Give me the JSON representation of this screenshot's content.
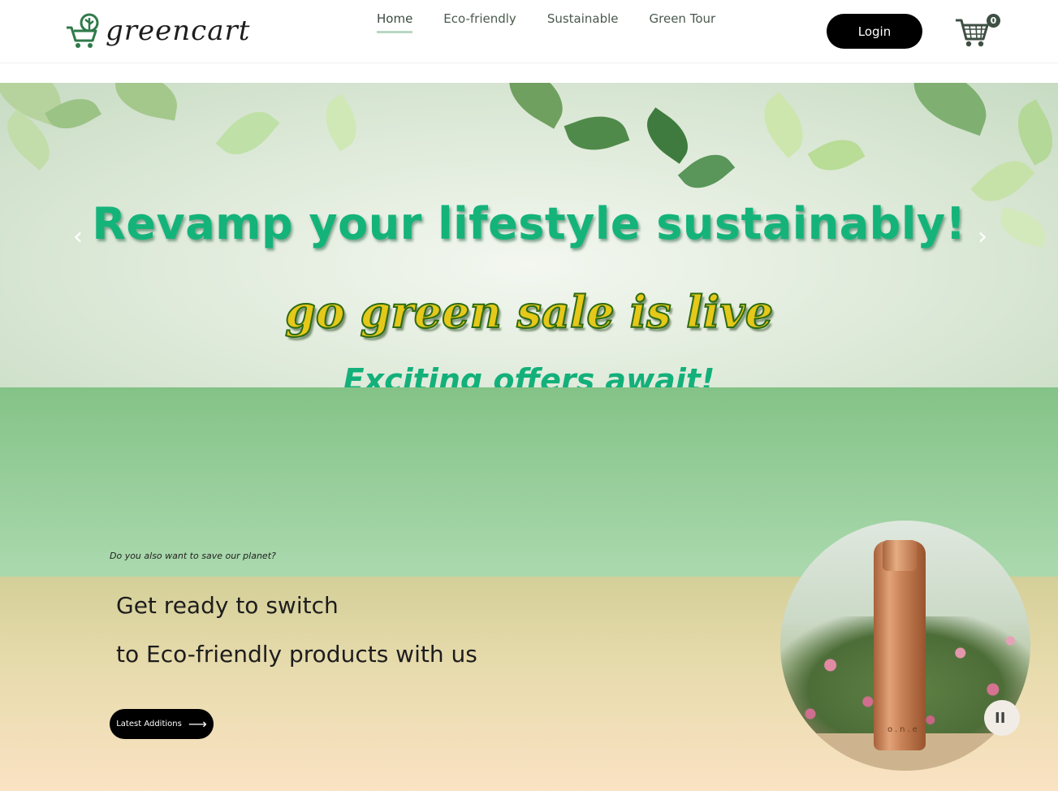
{
  "brand": {
    "name": "greencart"
  },
  "nav": {
    "items": [
      {
        "label": "Home",
        "active": true
      },
      {
        "label": "Eco-friendly",
        "active": false
      },
      {
        "label": "Sustainable",
        "active": false
      },
      {
        "label": "Green Tour",
        "active": false
      }
    ]
  },
  "header": {
    "login_label": "Login",
    "cart_count": "0"
  },
  "hero": {
    "title": "Revamp your lifestyle sustainably!",
    "sale": "go green sale is live",
    "offers": "Exciting offers await!",
    "prev_icon": "chevron-left-icon",
    "next_icon": "chevron-right-icon"
  },
  "promo": {
    "question": "Do you also want to save our planet?",
    "line_one": "Get ready to switch",
    "line_two": "to Eco-friendly products with us",
    "button_label": "Latest Additions",
    "button_icon": "arrow-right-icon",
    "product_brand": "o.n.e",
    "pause_label": "II"
  },
  "colors": {
    "accent_green": "#14b37a",
    "sale_yellow": "#e5c81a",
    "button_black": "#000000",
    "promo_top": "#84c387",
    "promo_bottom": "#fae2c3"
  }
}
